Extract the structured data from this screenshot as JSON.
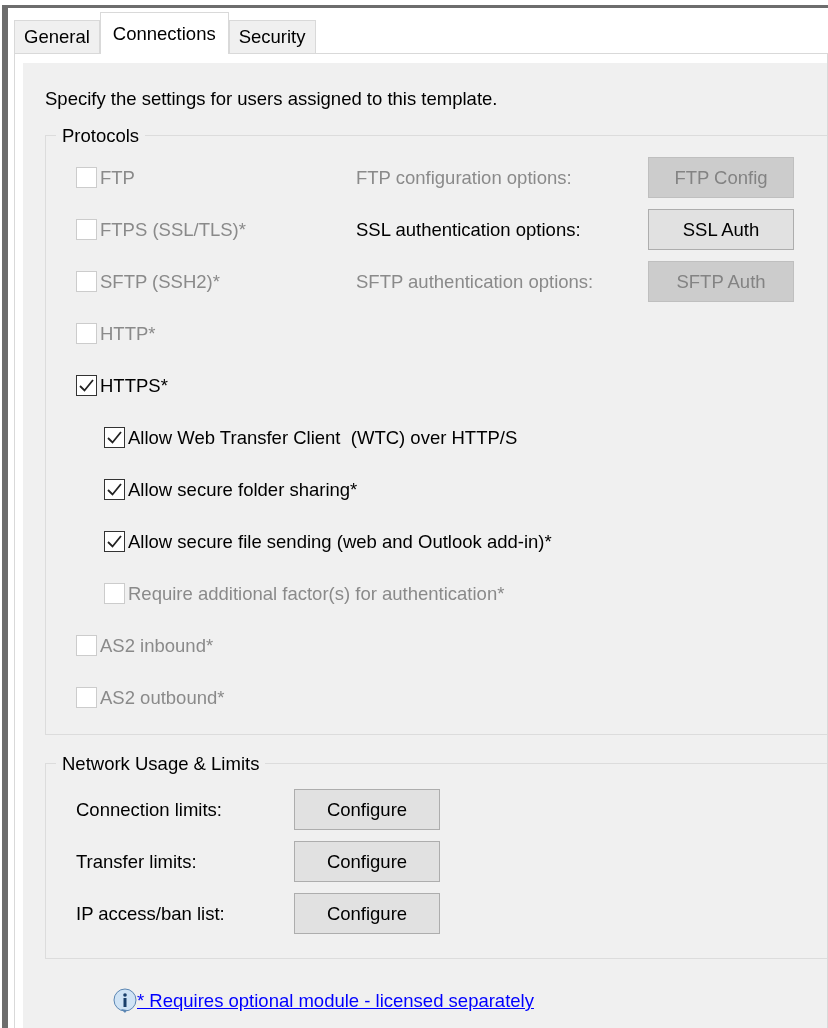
{
  "tabs": [
    {
      "label": "General",
      "selected": false
    },
    {
      "label": "Connections",
      "selected": true
    },
    {
      "label": "Security",
      "selected": false
    }
  ],
  "intro": "Specify the settings for users assigned to this template.",
  "protocols": {
    "title": "Protocols",
    "items": [
      {
        "label": "FTP",
        "checked": false,
        "disabled": true,
        "option": {
          "label": "FTP configuration options:",
          "button": "FTP Config",
          "disabled": true
        }
      },
      {
        "label": "FTPS (SSL/TLS)*",
        "checked": false,
        "disabled": true,
        "option": {
          "label": "SSL authentication options:",
          "button": "SSL Auth",
          "disabled": false
        }
      },
      {
        "label": "SFTP (SSH2)*",
        "checked": false,
        "disabled": true,
        "option": {
          "label": "SFTP authentication options:",
          "button": "SFTP Auth",
          "disabled": true
        }
      },
      {
        "label": "HTTP*",
        "checked": false,
        "disabled": true
      },
      {
        "label": "HTTPS*",
        "checked": true,
        "disabled": false,
        "children": [
          {
            "label": "Allow Web Transfer Client  (WTC) over HTTP/S",
            "checked": true,
            "disabled": false
          },
          {
            "label": "Allow secure folder sharing*",
            "checked": true,
            "disabled": false
          },
          {
            "label": "Allow secure file sending (web and Outlook add-in)*",
            "checked": true,
            "disabled": false
          },
          {
            "label": "Require additional factor(s) for authentication*",
            "checked": false,
            "disabled": true
          }
        ]
      },
      {
        "label": "AS2 inbound*",
        "checked": false,
        "disabled": true
      },
      {
        "label": "AS2 outbound*",
        "checked": false,
        "disabled": true
      }
    ]
  },
  "network": {
    "title": "Network Usage & Limits",
    "rows": [
      {
        "label": "Connection limits:",
        "button": "Configure"
      },
      {
        "label": "Transfer limits:",
        "button": "Configure"
      },
      {
        "label": "IP access/ban list:",
        "button": "Configure"
      }
    ]
  },
  "footer_link": "* Requires optional module - licensed separately"
}
